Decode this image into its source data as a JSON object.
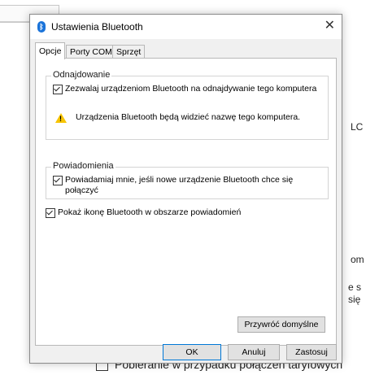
{
  "background": {
    "fragment_lc": "LC",
    "fragment_om": "om",
    "fragment_es": "e s",
    "fragment_sie": "się",
    "bottom_checkbox_label": "Pobieranie w przypadku połączeń taryfowych"
  },
  "dialog": {
    "title": "Ustawienia Bluetooth",
    "close_glyph": "✕",
    "tabs": [
      {
        "label": "Opcje",
        "active": true
      },
      {
        "label": "Porty COM",
        "active": false
      },
      {
        "label": "Sprzęt",
        "active": false
      }
    ],
    "discovery": {
      "title": "Odnajdowanie",
      "checkbox_label": "Zezwalaj urządzeniom Bluetooth na odnajdywanie tego komputera",
      "checked": true,
      "warning_icon": "warning-icon",
      "warning_text": "Urządzenia Bluetooth będą widzieć nazwę tego komputera."
    },
    "notifications": {
      "title": "Powiadomienia",
      "checkbox_label": "Powiadamiaj mnie, jeśli nowe urządzenie Bluetooth chce się połączyć",
      "checked": true
    },
    "show_icon": {
      "checkbox_label": "Pokaż ikonę Bluetooth w obszarze powiadomień",
      "checked": true
    },
    "restore_defaults_label": "Przywróć domyślne",
    "ok_label": "OK",
    "cancel_label": "Anuluj",
    "apply_label": "Zastosuj"
  },
  "colors": {
    "accent": "#0078d7",
    "bluetooth_icon": "#1a73d9",
    "warning": "#f7c400"
  }
}
